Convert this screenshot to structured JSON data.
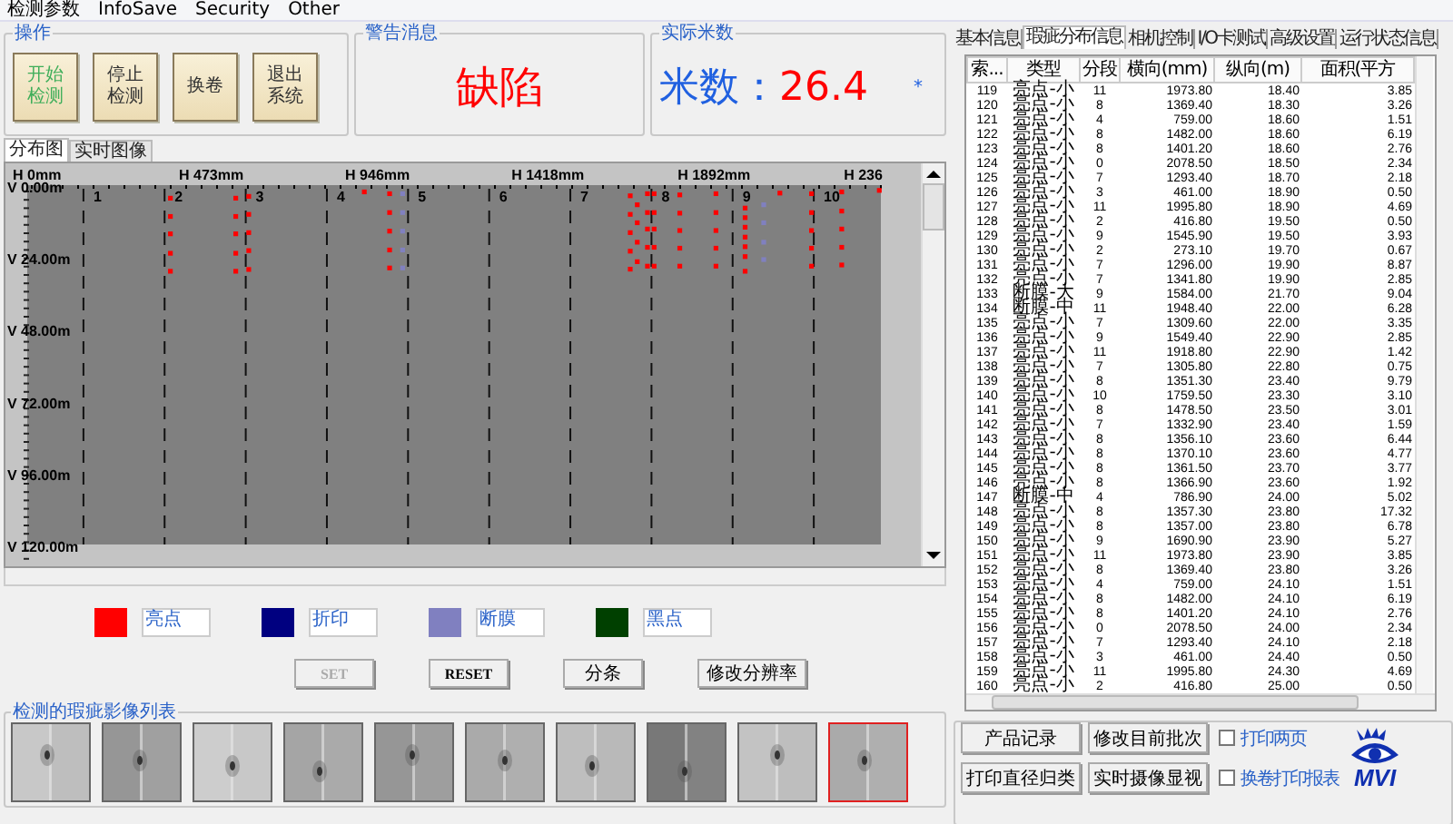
{
  "menu": [
    "检测参数",
    "InfoSave",
    "Security",
    "Other"
  ],
  "operations": {
    "title": "操作",
    "buttons": [
      {
        "lines": [
          "开始",
          "检测"
        ],
        "active": true
      },
      {
        "lines": [
          "停止",
          "检测"
        ],
        "active": false
      },
      {
        "lines": [
          "换卷"
        ],
        "active": false
      },
      {
        "lines": [
          "退出",
          "系统"
        ],
        "active": false
      }
    ]
  },
  "warning": {
    "title": "警告消息",
    "message": "缺陷"
  },
  "meter": {
    "title": "实际米数",
    "label": "米数：",
    "value": "26.4",
    "mark": "*"
  },
  "view_tabs": [
    {
      "label": "分布图",
      "selected": true
    },
    {
      "label": "实时图像",
      "selected": false
    }
  ],
  "distribution": {
    "segments": [
      "1",
      "2",
      "3",
      "4",
      "5",
      "6",
      "7",
      "8",
      "9",
      "10"
    ],
    "x_labels": [
      "H 0mm",
      "H 473mm",
      "H 946mm",
      "H 1418mm",
      "H 1892mm",
      "H 236"
    ],
    "y_labels": [
      "V 0.00m",
      "V 24.00m",
      "V 48.00m",
      "V 72.00m",
      "V 96.00m",
      "V 120.00m"
    ],
    "kind": "defect-map"
  },
  "legend": [
    {
      "color": "#ff0000",
      "label": "亮点"
    },
    {
      "color": "#000080",
      "label": "折印"
    },
    {
      "color": "#8080c0",
      "label": "断膜"
    },
    {
      "color": "#004000",
      "label": "黑点"
    }
  ],
  "actions": [
    {
      "label": "SET",
      "disabled": true
    },
    {
      "label": "RESET",
      "disabled": false
    },
    {
      "label": "分条",
      "disabled": false
    },
    {
      "label": "修改分辨率",
      "disabled": false
    }
  ],
  "image_list": {
    "title": "检测的瑕疵影像列表",
    "items": [
      {
        "kind": "picture",
        "selected": false
      },
      {
        "kind": "picture",
        "selected": false
      },
      {
        "kind": "picture",
        "selected": false
      },
      {
        "kind": "picture",
        "selected": false
      },
      {
        "kind": "picture",
        "selected": false
      },
      {
        "kind": "picture",
        "selected": false
      },
      {
        "kind": "picture",
        "selected": false
      },
      {
        "kind": "picture",
        "selected": false
      },
      {
        "kind": "picture",
        "selected": false
      },
      {
        "kind": "picture",
        "selected": true
      }
    ]
  },
  "info_tabs": [
    {
      "label": "基本信息",
      "selected": false
    },
    {
      "label": "瑕疵分布信息",
      "selected": true
    },
    {
      "label": "相机控制",
      "selected": false
    },
    {
      "label": "I/O卡测试",
      "selected": false
    },
    {
      "label": "高级设置",
      "selected": false
    },
    {
      "label": "运行状态信息",
      "selected": false
    }
  ],
  "table": {
    "columns": [
      "索...",
      "类型",
      "分段",
      "横向(mm)",
      "纵向(m)",
      "面积(平方"
    ],
    "rows": [
      [
        "119",
        "亮点-小",
        "11",
        "1973.80",
        "18.40",
        "3.85"
      ],
      [
        "120",
        "亮点-小",
        "8",
        "1369.40",
        "18.30",
        "3.26"
      ],
      [
        "121",
        "亮点-小",
        "4",
        "759.00",
        "18.60",
        "1.51"
      ],
      [
        "122",
        "亮点-小",
        "8",
        "1482.00",
        "18.60",
        "6.19"
      ],
      [
        "123",
        "亮点-小",
        "8",
        "1401.20",
        "18.60",
        "2.76"
      ],
      [
        "124",
        "亮点-小",
        "0",
        "2078.50",
        "18.50",
        "2.34"
      ],
      [
        "125",
        "亮点-小",
        "7",
        "1293.40",
        "18.70",
        "2.18"
      ],
      [
        "126",
        "亮点-小",
        "3",
        "461.00",
        "18.90",
        "0.50"
      ],
      [
        "127",
        "亮点-小",
        "11",
        "1995.80",
        "18.90",
        "4.69"
      ],
      [
        "128",
        "亮点-小",
        "2",
        "416.80",
        "19.50",
        "0.50"
      ],
      [
        "129",
        "亮点-小",
        "9",
        "1545.90",
        "19.50",
        "3.93"
      ],
      [
        "130",
        "亮点-小",
        "2",
        "273.10",
        "19.70",
        "0.67"
      ],
      [
        "131",
        "亮点-小",
        "7",
        "1296.00",
        "19.90",
        "8.87"
      ],
      [
        "132",
        "亮点-小",
        "7",
        "1341.80",
        "19.90",
        "2.85"
      ],
      [
        "133",
        "断膜-大",
        "9",
        "1584.00",
        "21.70",
        "9.04"
      ],
      [
        "134",
        "断膜-中",
        "11",
        "1948.40",
        "22.00",
        "6.28"
      ],
      [
        "135",
        "亮点-小",
        "7",
        "1309.60",
        "22.00",
        "3.35"
      ],
      [
        "136",
        "亮点-小",
        "9",
        "1549.40",
        "22.90",
        "2.85"
      ],
      [
        "137",
        "亮点-小",
        "11",
        "1918.80",
        "22.90",
        "1.42"
      ],
      [
        "138",
        "亮点-小",
        "7",
        "1305.80",
        "22.80",
        "0.75"
      ],
      [
        "139",
        "亮点-小",
        "8",
        "1351.30",
        "23.40",
        "9.79"
      ],
      [
        "140",
        "亮点-小",
        "10",
        "1759.50",
        "23.30",
        "3.10"
      ],
      [
        "141",
        "亮点-小",
        "8",
        "1478.50",
        "23.50",
        "3.01"
      ],
      [
        "142",
        "亮点-小",
        "7",
        "1332.90",
        "23.40",
        "1.59"
      ],
      [
        "143",
        "亮点-小",
        "8",
        "1356.10",
        "23.60",
        "6.44"
      ],
      [
        "144",
        "亮点-小",
        "8",
        "1370.10",
        "23.60",
        "4.77"
      ],
      [
        "145",
        "亮点-小",
        "8",
        "1361.50",
        "23.70",
        "3.77"
      ],
      [
        "146",
        "亮点-小",
        "8",
        "1366.90",
        "23.60",
        "1.92"
      ],
      [
        "147",
        "断膜-中",
        "4",
        "786.90",
        "24.00",
        "5.02"
      ],
      [
        "148",
        "亮点-小",
        "8",
        "1357.30",
        "23.80",
        "17.32"
      ],
      [
        "149",
        "亮点-小",
        "8",
        "1357.00",
        "23.80",
        "6.78"
      ],
      [
        "150",
        "亮点-小",
        "9",
        "1690.90",
        "23.90",
        "5.27"
      ],
      [
        "151",
        "亮点-小",
        "11",
        "1973.80",
        "23.90",
        "3.85"
      ],
      [
        "152",
        "亮点-小",
        "8",
        "1369.40",
        "23.80",
        "3.26"
      ],
      [
        "153",
        "亮点-小",
        "4",
        "759.00",
        "24.10",
        "1.51"
      ],
      [
        "154",
        "亮点-小",
        "8",
        "1482.00",
        "24.10",
        "6.19"
      ],
      [
        "155",
        "亮点-小",
        "8",
        "1401.20",
        "24.10",
        "2.76"
      ],
      [
        "156",
        "亮点-小",
        "0",
        "2078.50",
        "24.00",
        "2.34"
      ],
      [
        "157",
        "亮点-小",
        "7",
        "1293.40",
        "24.10",
        "2.18"
      ],
      [
        "158",
        "亮点-小",
        "3",
        "461.00",
        "24.40",
        "0.50"
      ],
      [
        "159",
        "亮点-小",
        "11",
        "1995.80",
        "24.30",
        "4.69"
      ],
      [
        "160",
        "亮点-小",
        "2",
        "416.80",
        "25.00",
        "0.50"
      ]
    ]
  },
  "record_panel": {
    "buttons": [
      "产品记录",
      "修改目前批次",
      "打印直径归类",
      "实时摄像显视"
    ],
    "checkboxes": [
      {
        "label": "打印两页",
        "checked": false
      },
      {
        "label": "换卷打印报表",
        "checked": false
      }
    ],
    "logo": "MVI"
  }
}
